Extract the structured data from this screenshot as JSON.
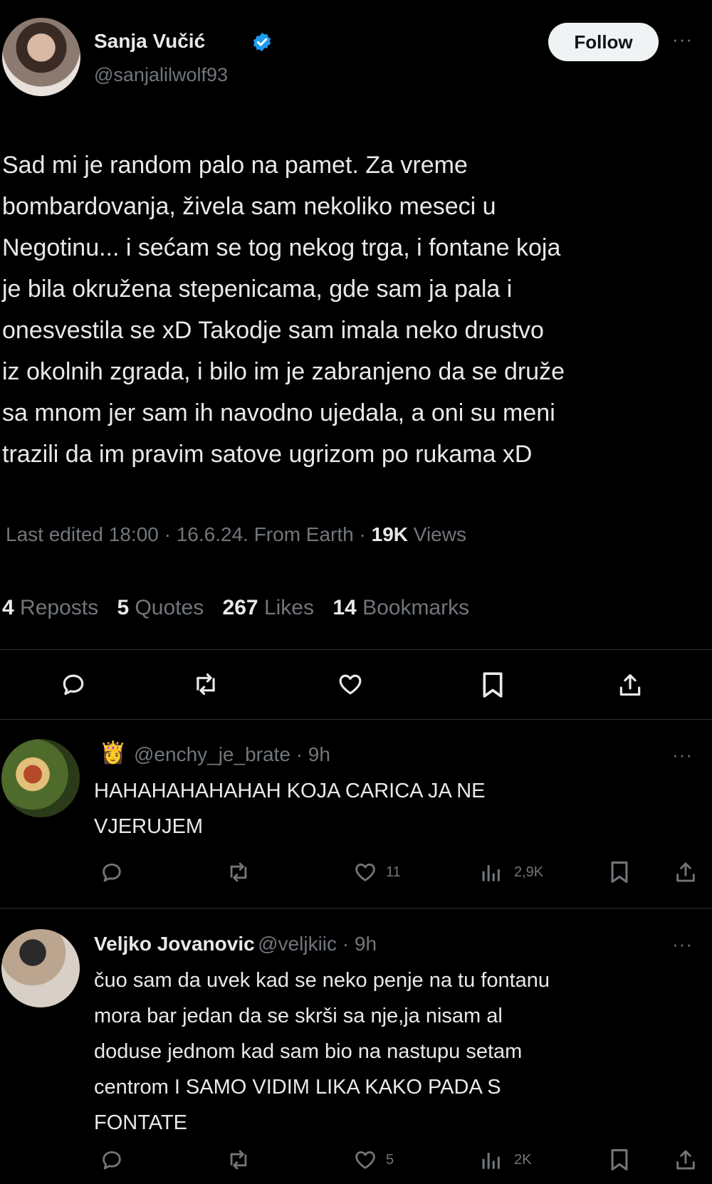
{
  "tweet": {
    "author_name": "Sanja Vučić",
    "author_handle": "@sanjalilwolf93",
    "follow_label": "Follow",
    "more_label": "···",
    "text_lines": [
      "Sad mi je random palo na pamet. Za vreme",
      "bombardovanja, živela sam nekoliko meseci u",
      "Negotinu... i sećam se tog nekog trga, i fontane koja",
      "je bila okružena stepenicama, gde sam ja pala i",
      "onesvestila se xD Takodje sam imala neko drustvo",
      "iz okolnih zgrada, i bilo im je zabranjeno da se druže",
      "sa mnom jer sam ih navodno ujedala, a oni su meni",
      "trazili da im pravim satove ugrizom po rukama xD"
    ],
    "meta_prefix": "Last edited 18:00 · 16.6.24. From Earth · ",
    "views_count": "19K",
    "views_label": "Views",
    "stats": {
      "reposts_count": "4",
      "reposts_label": "Reposts",
      "quotes_count": "5",
      "quotes_label": "Quotes",
      "likes_count": "267",
      "likes_label": "Likes",
      "bookmarks_count": "14",
      "bookmarks_label": "Bookmarks"
    },
    "action_icons": [
      "reply-icon",
      "repost-icon",
      "like-icon",
      "bookmark-icon",
      "share-icon"
    ]
  },
  "replies": [
    {
      "emoji": "👸",
      "handle_time": "@enchy_je_brate · 9h",
      "text_lines": [
        "HAHAHAHAHAHAH KOJA CARICA JA NE",
        "VJERUJEM"
      ],
      "likes": "11",
      "views": "2,9K",
      "more_label": "···"
    },
    {
      "name": "Veljko Jovanovic",
      "handle_time": "@veljkiic · 9h",
      "text_lines": [
        "čuo sam da uvek kad se neko penje na tu fontanu",
        "mora bar jedan da se skrši sa nje,ja nisam al",
        "doduse jednom kad sam bio na nastupu setam",
        "centrom I SAMO VIDIM LIKA KAKO PADA S",
        "FONTATE"
      ],
      "likes": "5",
      "views": "2K",
      "more_label": "···"
    }
  ],
  "colors": {
    "background": "#000000",
    "text_primary": "#e7e9ea",
    "text_secondary": "#71767b",
    "verified_blue": "#1d9bf0",
    "divider": "#2f3336"
  }
}
